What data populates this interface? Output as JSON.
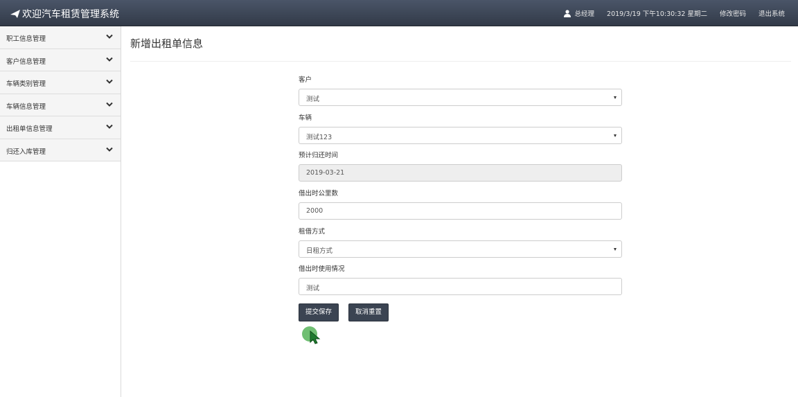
{
  "app": {
    "title": "欢迎汽车租赁管理系统"
  },
  "header": {
    "user": "总经理",
    "datetime": "2019/3/19 下午10:30:32 星期二",
    "change_password": "修改密码",
    "logout": "退出系统"
  },
  "sidebar": {
    "items": [
      {
        "label": "职工信息管理"
      },
      {
        "label": "客户信息管理"
      },
      {
        "label": "车辆类别管理"
      },
      {
        "label": "车辆信息管理"
      },
      {
        "label": "出租单信息管理"
      },
      {
        "label": "归还入库管理"
      }
    ]
  },
  "page": {
    "title": "新增出租单信息"
  },
  "form": {
    "customer": {
      "label": "客户",
      "value": "测试"
    },
    "vehicle": {
      "label": "车辆",
      "value": "测试123"
    },
    "return_time": {
      "label": "预计归还时间",
      "value": "2019-03-21"
    },
    "mileage": {
      "label": "借出时公里数",
      "value": "2000"
    },
    "rent_type": {
      "label": "租借方式",
      "value": "日租方式"
    },
    "usage": {
      "label": "借出时使用情况",
      "value": "测试"
    },
    "submit_label": "提交保存",
    "reset_label": "取消重置"
  },
  "colors": {
    "navbar": "#3a4252",
    "button": "#3b4452",
    "cursor": "#4caf50"
  }
}
